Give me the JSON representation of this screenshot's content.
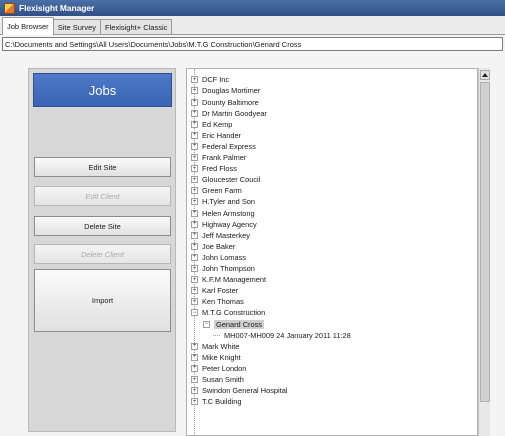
{
  "window": {
    "title": "Flexisight Manager"
  },
  "tabs": [
    {
      "label": "Job Browser",
      "active": true
    },
    {
      "label": "Site Survey",
      "active": false
    },
    {
      "label": "Flexisight+ Classic",
      "active": false
    }
  ],
  "path": "C:\\Documents and Settings\\All Users\\Documents\\Jobs\\M.T.G Construction\\Genard Cross",
  "left_panel": {
    "header": "Jobs",
    "buttons": {
      "edit_site": "Edit Site",
      "edit_client": "Edit Client",
      "delete_site": "Delete Site",
      "delete_client": "Delete Client",
      "import": "Import"
    }
  },
  "tree": {
    "items": [
      "DCF Inc",
      "Douglas Mortimer",
      "Dounty Baltimore",
      "Dr Martin Goodyear",
      "Ed Kemp",
      "Eric Hander",
      "Federal Express",
      "Frank Palmer",
      "Fred Floss",
      "Gloucester Coucil",
      "Green Farm",
      "H.Tyler and Son",
      "Helen Armstong",
      "Highway Agency",
      "Jeff Masterkey",
      "Joe Baker",
      "John Lomass",
      "John Thompson",
      "K.F.M Management",
      "Karl Foster",
      "Ken Thomas",
      "M.T.G Construction",
      "Genard Cross",
      "MH007-MH009 24 January 2011 11:28",
      "Mark White",
      "Mike Knight",
      "Peter London",
      "Susan Smith",
      "Swindon General Hospital",
      "T.C Building"
    ],
    "expander_collapsed": "+",
    "expander_expanded": "−"
  }
}
